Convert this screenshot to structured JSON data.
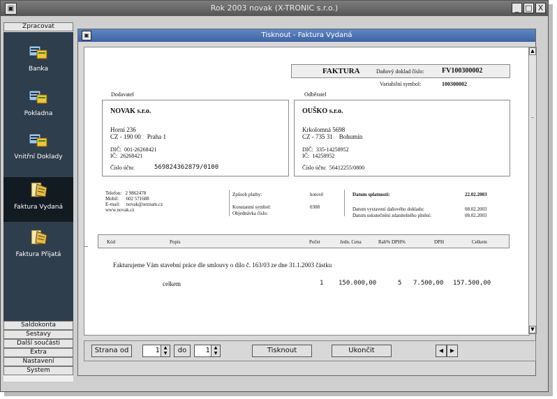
{
  "window": {
    "title": "Rok 2003 novak (X-TRONIC s.r.o.)",
    "buttons": [
      "_",
      "□",
      "X"
    ]
  },
  "sidebar": {
    "top_button": "Zpracovat",
    "items": [
      {
        "label": "Banka",
        "icon": "bank-icon"
      },
      {
        "label": "Pokladna",
        "icon": "cash-register-icon"
      },
      {
        "label": "Vnitřní Doklady",
        "icon": "internal-documents-icon"
      },
      {
        "label": "Faktura Vydaná",
        "icon": "issued-invoice-icon",
        "active": true
      },
      {
        "label": "Faktura Přijatá",
        "icon": "received-invoice-icon"
      }
    ],
    "bottom_buttons": [
      "Saldokonta",
      "Sestavy",
      "Další součásti",
      "Extra",
      "Nastavení",
      "System"
    ]
  },
  "dialog": {
    "title": "Tisknout - Faktura Vydaná"
  },
  "invoice": {
    "heading": "FAKTURA",
    "doc_label": "Daňový doklad číslo:",
    "doc_number": "FV100300002",
    "var_symbol_label": "Variabilní symbol:",
    "var_symbol": "100300002",
    "supplier_label": "Dodavatel",
    "customer_label": "Odběratel",
    "supplier": {
      "name": "NOVAK s.r.o.",
      "street": "Horní 236",
      "city": "CZ - 190 00    Praha 1",
      "dic": "DIČ:  001-26268421",
      "ic": "IČ:  26268421",
      "account_label": "Číslo účtu:",
      "account": "569824362879/0100"
    },
    "customer": {
      "name": "OUŠKO s.r.o.",
      "street": "Krkolomná 5698",
      "city": "CZ - 735 31    Bohumín",
      "dic": "DIČ:  335-14258952",
      "ic": "IČ:  14258952",
      "account": "Číslo účtu:  56412255/0800"
    },
    "contact": {
      "phone": "Telefon:   2 9862478",
      "mobile": "Mobil:      602 571688",
      "email": "E-mail:     novak@seznam.cz",
      "web": "www.novak.cz"
    },
    "payment": {
      "method_label": "Způsob platby:",
      "method": "hotově",
      "const_label": "Konstantní symbol:",
      "const": "0308",
      "order_label": "Objednávka číslo:"
    },
    "dates": {
      "due_label": "Datum splatnosti:",
      "due": "22.02.2003",
      "issued_label": "Datum vystavení daňového dokladu:",
      "issued": "08.02.2003",
      "taxable_label": "Datum uskutečnění zdanitelného plnění:",
      "taxable": "08.02.2003"
    },
    "columns": [
      "Kód",
      "Popis",
      "Počet",
      "Jedn. Cena",
      "Rab%",
      "DPH%",
      "DPH",
      "Celkem"
    ],
    "description": "Fakturujeme Vám stavební práce dle smlouvy o dílo č. 163/03 ze dne 31.1.2003 částku",
    "line": {
      "label": "celkem",
      "qty": "1",
      "unit_price": "150.000,00",
      "vat_pct": "5",
      "vat": "7.500,00",
      "total": "157.500,00"
    }
  },
  "controls": {
    "from_label": "Strana od",
    "from_value": "1",
    "to_label": "do",
    "to_value": "1",
    "print_label": "Tisknout",
    "close_label": "Ukončit"
  }
}
